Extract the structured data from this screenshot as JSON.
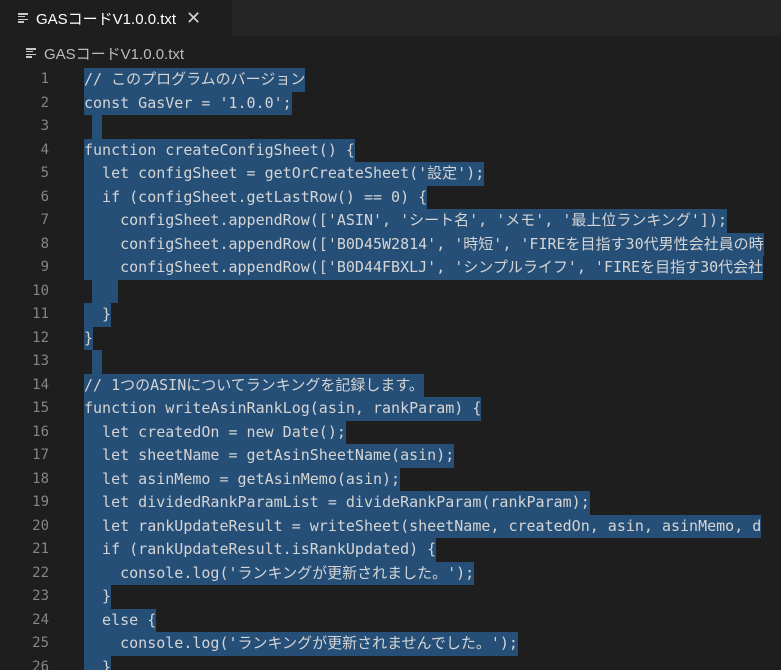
{
  "tab": {
    "title": "GASコードV1.0.0.txt",
    "close_glyph": "✕",
    "icon": "file-text-icon"
  },
  "breadcrumb": {
    "file": "GASコードV1.0.0.txt",
    "icon": "file-text-icon"
  },
  "editor": {
    "lines": [
      {
        "n": "1",
        "text": "// このプログラムのバージョン"
      },
      {
        "n": "2",
        "text": "const GasVer = '1.0.0';"
      },
      {
        "n": "3",
        "text": ""
      },
      {
        "n": "4",
        "text": "function createConfigSheet() {"
      },
      {
        "n": "5",
        "text": "  let configSheet = getOrCreateSheet('設定');"
      },
      {
        "n": "6",
        "text": "  if (configSheet.getLastRow() == 0) {"
      },
      {
        "n": "7",
        "text": "    configSheet.appendRow(['ASIN', 'シート名', 'メモ', '最上位ランキング']);"
      },
      {
        "n": "8",
        "text": "    configSheet.appendRow(['B0D45W2814', '時短', 'FIREを目指す30代男性会社員の時"
      },
      {
        "n": "9",
        "text": "    configSheet.appendRow(['B0D44FBXLJ', 'シンプルライフ', 'FIREを目指す30代会社"
      },
      {
        "n": "10",
        "text": ""
      },
      {
        "n": "11",
        "text": "  }"
      },
      {
        "n": "12",
        "text": "}"
      },
      {
        "n": "13",
        "text": ""
      },
      {
        "n": "14",
        "text": "// 1つのASINについてランキングを記録します。"
      },
      {
        "n": "15",
        "text": "function writeAsinRankLog(asin, rankParam) {"
      },
      {
        "n": "16",
        "text": "  let createdOn = new Date();"
      },
      {
        "n": "17",
        "text": "  let sheetName = getAsinSheetName(asin);"
      },
      {
        "n": "18",
        "text": "  let asinMemo = getAsinMemo(asin);"
      },
      {
        "n": "19",
        "text": "  let dividedRankParamList = divideRankParam(rankParam);"
      },
      {
        "n": "20",
        "text": "  let rankUpdateResult = writeSheet(sheetName, createdOn, asin, asinMemo, d"
      },
      {
        "n": "21",
        "text": "  if (rankUpdateResult.isRankUpdated) {"
      },
      {
        "n": "22",
        "text": "    console.log('ランキングが更新されました。');"
      },
      {
        "n": "23",
        "text": "  }"
      },
      {
        "n": "24",
        "text": "  else {"
      },
      {
        "n": "25",
        "text": "    console.log('ランキングが更新されませんでした。');"
      },
      {
        "n": "26",
        "text": "  }"
      }
    ]
  },
  "colors": {
    "background": "#1e1e1e",
    "selection": "#264f78",
    "line_number": "#858585",
    "code_text": "#d4d4d4"
  }
}
